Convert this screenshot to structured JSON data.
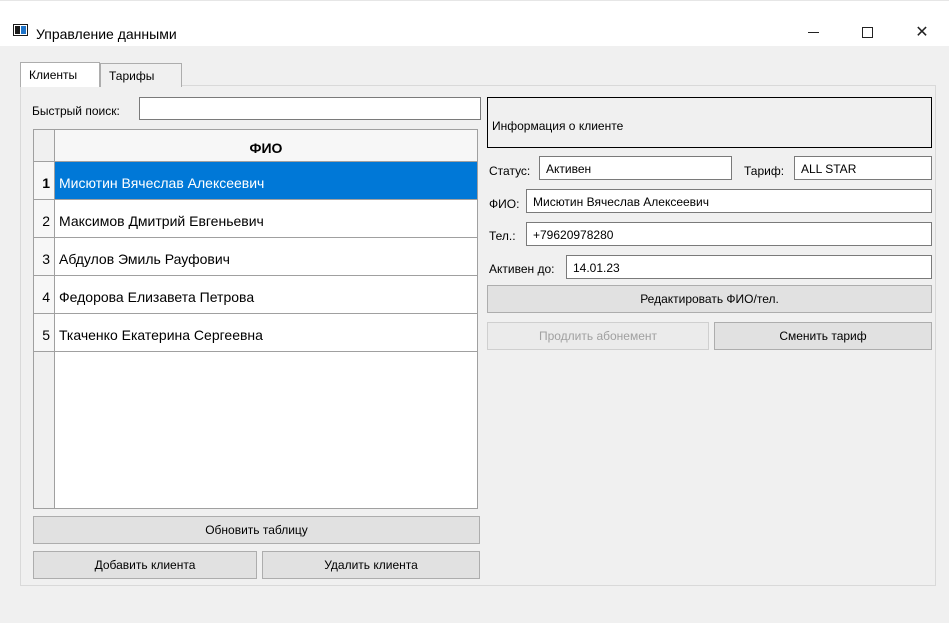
{
  "window": {
    "title": "Управление данными"
  },
  "tabs": [
    {
      "label": "Клиенты"
    },
    {
      "label": "Тарифы"
    }
  ],
  "search": {
    "label": "Быстрый поиск:",
    "value": ""
  },
  "table": {
    "header": "ФИО",
    "rows": [
      {
        "num": "1",
        "name": "Мисютин Вячеслав Алексеевич"
      },
      {
        "num": "2",
        "name": "Максимов Дмитрий Евгеньевич"
      },
      {
        "num": "3",
        "name": "Абдулов Эмиль Рауфович"
      },
      {
        "num": "4",
        "name": "Федорова Елизавета Петрова"
      },
      {
        "num": "5",
        "name": "Ткаченко Екатерина Сергеевна"
      }
    ],
    "selected_row": 0
  },
  "buttons": {
    "refresh": "Обновить таблицу",
    "add": "Добавить клиента",
    "delete": "Удалить клиента",
    "edit": "Редактировать ФИО/тел.",
    "extend": "Продлить абонемент",
    "change_tariff": "Сменить тариф"
  },
  "client_info": {
    "heading": "Информация о клиенте",
    "status_label": "Статус:",
    "status_value": "Активен",
    "tariff_label": "Тариф:",
    "tariff_value": "ALL STAR",
    "fio_label": "ФИО:",
    "fio_value": "Мисютин Вячеслав Алексеевич",
    "phone_label": "Тел.:",
    "phone_value": "+79620978280",
    "active_until_label": "Активен до:",
    "active_until_value": "14.01.23"
  },
  "colors": {
    "selection": "#0078d7",
    "window_bg": "#f0f0f0"
  }
}
